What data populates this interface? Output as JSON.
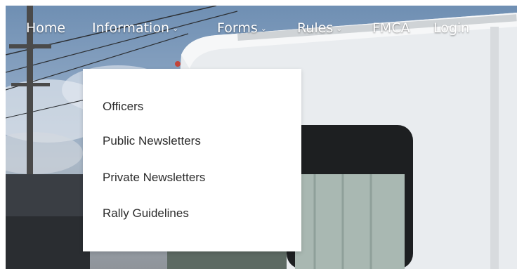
{
  "nav": {
    "home": "Home",
    "information": "Information",
    "forms": "Forms",
    "rules": "Rules",
    "fmca": "FMCA",
    "login": "Login",
    "caret": "⌄"
  },
  "dropdown": {
    "items": [
      "Officers",
      "Public Newsletters",
      "Private Newsletters",
      "Rally Guidelines"
    ]
  },
  "colors": {
    "nav_text": "#ffffff",
    "dropdown_bg": "#ffffff",
    "dropdown_text": "#2b2b2b"
  }
}
